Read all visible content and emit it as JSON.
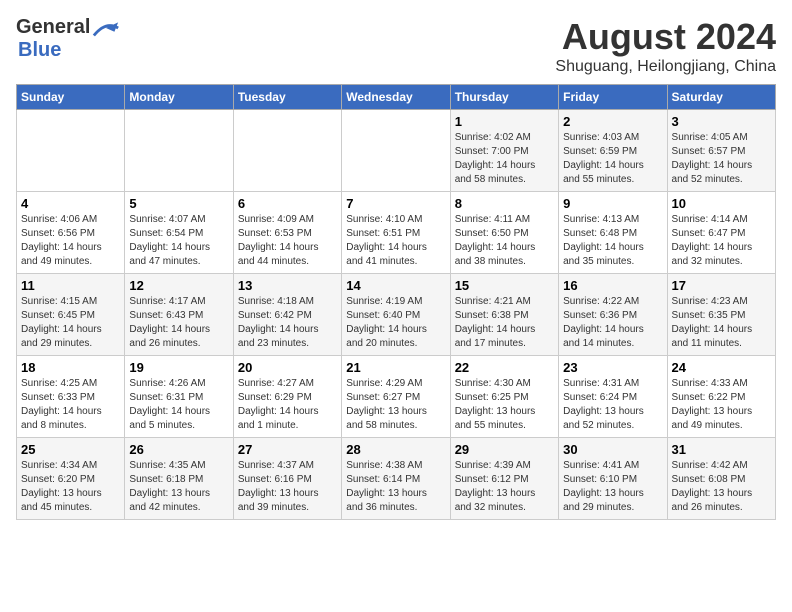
{
  "header": {
    "logo": {
      "general": "General",
      "blue": "Blue"
    },
    "title": "August 2024",
    "location": "Shuguang, Heilongjiang, China"
  },
  "days_of_week": [
    "Sunday",
    "Monday",
    "Tuesday",
    "Wednesday",
    "Thursday",
    "Friday",
    "Saturday"
  ],
  "weeks": [
    [
      {
        "day": "",
        "info": ""
      },
      {
        "day": "",
        "info": ""
      },
      {
        "day": "",
        "info": ""
      },
      {
        "day": "",
        "info": ""
      },
      {
        "day": "1",
        "info": "Sunrise: 4:02 AM\nSunset: 7:00 PM\nDaylight: 14 hours\nand 58 minutes."
      },
      {
        "day": "2",
        "info": "Sunrise: 4:03 AM\nSunset: 6:59 PM\nDaylight: 14 hours\nand 55 minutes."
      },
      {
        "day": "3",
        "info": "Sunrise: 4:05 AM\nSunset: 6:57 PM\nDaylight: 14 hours\nand 52 minutes."
      }
    ],
    [
      {
        "day": "4",
        "info": "Sunrise: 4:06 AM\nSunset: 6:56 PM\nDaylight: 14 hours\nand 49 minutes."
      },
      {
        "day": "5",
        "info": "Sunrise: 4:07 AM\nSunset: 6:54 PM\nDaylight: 14 hours\nand 47 minutes."
      },
      {
        "day": "6",
        "info": "Sunrise: 4:09 AM\nSunset: 6:53 PM\nDaylight: 14 hours\nand 44 minutes."
      },
      {
        "day": "7",
        "info": "Sunrise: 4:10 AM\nSunset: 6:51 PM\nDaylight: 14 hours\nand 41 minutes."
      },
      {
        "day": "8",
        "info": "Sunrise: 4:11 AM\nSunset: 6:50 PM\nDaylight: 14 hours\nand 38 minutes."
      },
      {
        "day": "9",
        "info": "Sunrise: 4:13 AM\nSunset: 6:48 PM\nDaylight: 14 hours\nand 35 minutes."
      },
      {
        "day": "10",
        "info": "Sunrise: 4:14 AM\nSunset: 6:47 PM\nDaylight: 14 hours\nand 32 minutes."
      }
    ],
    [
      {
        "day": "11",
        "info": "Sunrise: 4:15 AM\nSunset: 6:45 PM\nDaylight: 14 hours\nand 29 minutes."
      },
      {
        "day": "12",
        "info": "Sunrise: 4:17 AM\nSunset: 6:43 PM\nDaylight: 14 hours\nand 26 minutes."
      },
      {
        "day": "13",
        "info": "Sunrise: 4:18 AM\nSunset: 6:42 PM\nDaylight: 14 hours\nand 23 minutes."
      },
      {
        "day": "14",
        "info": "Sunrise: 4:19 AM\nSunset: 6:40 PM\nDaylight: 14 hours\nand 20 minutes."
      },
      {
        "day": "15",
        "info": "Sunrise: 4:21 AM\nSunset: 6:38 PM\nDaylight: 14 hours\nand 17 minutes."
      },
      {
        "day": "16",
        "info": "Sunrise: 4:22 AM\nSunset: 6:36 PM\nDaylight: 14 hours\nand 14 minutes."
      },
      {
        "day": "17",
        "info": "Sunrise: 4:23 AM\nSunset: 6:35 PM\nDaylight: 14 hours\nand 11 minutes."
      }
    ],
    [
      {
        "day": "18",
        "info": "Sunrise: 4:25 AM\nSunset: 6:33 PM\nDaylight: 14 hours\nand 8 minutes."
      },
      {
        "day": "19",
        "info": "Sunrise: 4:26 AM\nSunset: 6:31 PM\nDaylight: 14 hours\nand 5 minutes."
      },
      {
        "day": "20",
        "info": "Sunrise: 4:27 AM\nSunset: 6:29 PM\nDaylight: 14 hours\nand 1 minute."
      },
      {
        "day": "21",
        "info": "Sunrise: 4:29 AM\nSunset: 6:27 PM\nDaylight: 13 hours\nand 58 minutes."
      },
      {
        "day": "22",
        "info": "Sunrise: 4:30 AM\nSunset: 6:25 PM\nDaylight: 13 hours\nand 55 minutes."
      },
      {
        "day": "23",
        "info": "Sunrise: 4:31 AM\nSunset: 6:24 PM\nDaylight: 13 hours\nand 52 minutes."
      },
      {
        "day": "24",
        "info": "Sunrise: 4:33 AM\nSunset: 6:22 PM\nDaylight: 13 hours\nand 49 minutes."
      }
    ],
    [
      {
        "day": "25",
        "info": "Sunrise: 4:34 AM\nSunset: 6:20 PM\nDaylight: 13 hours\nand 45 minutes."
      },
      {
        "day": "26",
        "info": "Sunrise: 4:35 AM\nSunset: 6:18 PM\nDaylight: 13 hours\nand 42 minutes."
      },
      {
        "day": "27",
        "info": "Sunrise: 4:37 AM\nSunset: 6:16 PM\nDaylight: 13 hours\nand 39 minutes."
      },
      {
        "day": "28",
        "info": "Sunrise: 4:38 AM\nSunset: 6:14 PM\nDaylight: 13 hours\nand 36 minutes."
      },
      {
        "day": "29",
        "info": "Sunrise: 4:39 AM\nSunset: 6:12 PM\nDaylight: 13 hours\nand 32 minutes."
      },
      {
        "day": "30",
        "info": "Sunrise: 4:41 AM\nSunset: 6:10 PM\nDaylight: 13 hours\nand 29 minutes."
      },
      {
        "day": "31",
        "info": "Sunrise: 4:42 AM\nSunset: 6:08 PM\nDaylight: 13 hours\nand 26 minutes."
      }
    ]
  ]
}
